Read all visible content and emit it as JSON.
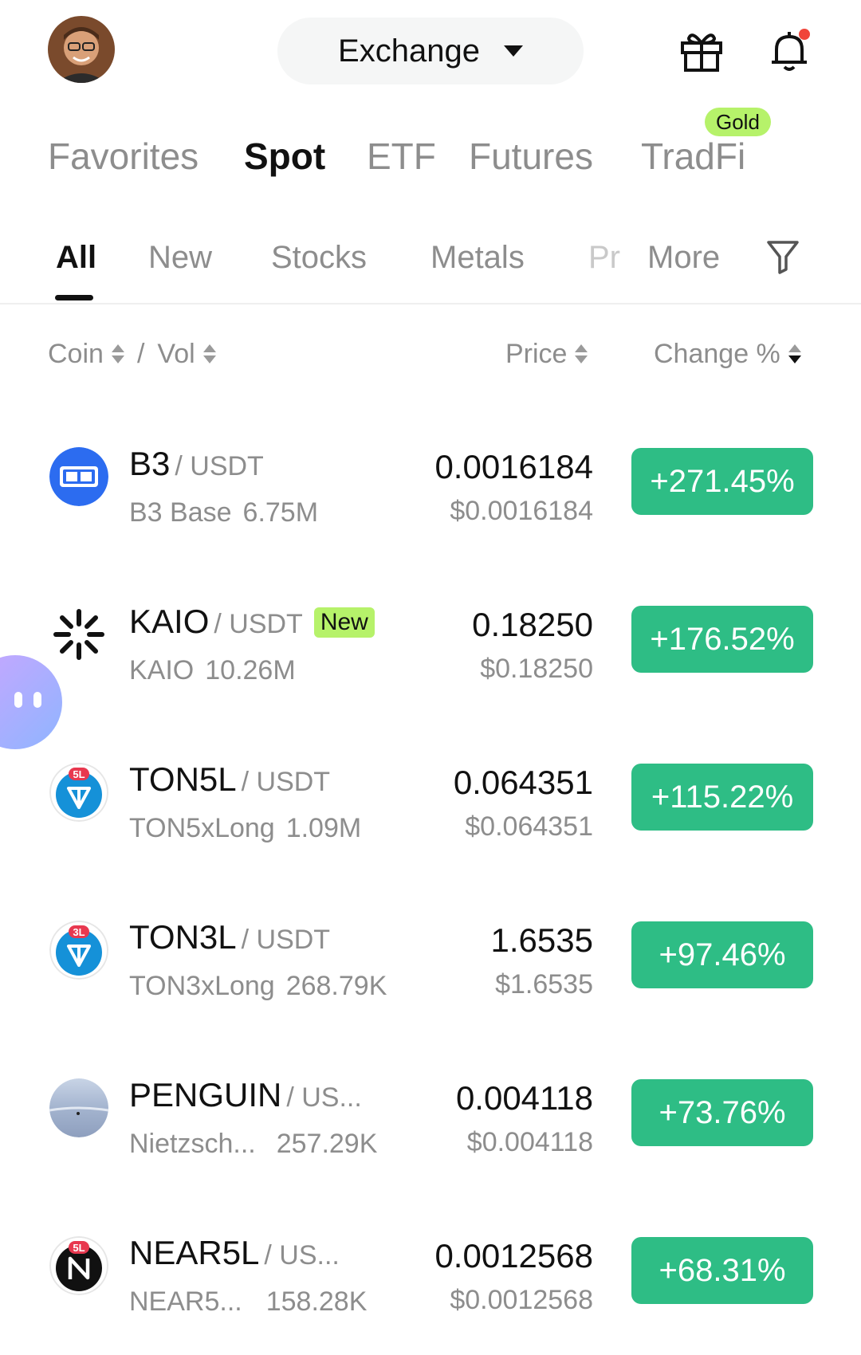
{
  "header": {
    "exchange_label": "Exchange",
    "notification_dot_color": "#f0453a"
  },
  "categories": [
    {
      "label": "Favorites",
      "active": false
    },
    {
      "label": "Spot",
      "active": true
    },
    {
      "label": "ETF",
      "active": false
    },
    {
      "label": "Futures",
      "active": false
    },
    {
      "label": "TradFi",
      "active": false,
      "badge": "Gold"
    }
  ],
  "subtabs": [
    "All",
    "New",
    "Stocks",
    "Metals",
    "Pr",
    "More"
  ],
  "columns": {
    "coin": "Coin",
    "sep": "/",
    "vol": "Vol",
    "price": "Price",
    "change": "Change %"
  },
  "rows": [
    {
      "symbol": "B3",
      "pair": "/ USDT",
      "name": "B3 Base",
      "volume": "6.75M",
      "price": "0.0016184",
      "fiat": "$0.0016184",
      "change": "+271.45%",
      "badge": "",
      "icon": "b3-coin-icon"
    },
    {
      "symbol": "KAIO",
      "pair": "/ USDT",
      "name": "KAIO",
      "volume": "10.26M",
      "price": "0.18250",
      "fiat": "$0.18250",
      "change": "+176.52%",
      "badge": "New",
      "icon": "kaio-coin-icon"
    },
    {
      "symbol": "TON5L",
      "pair": "/ USDT",
      "name": "TON5xLong",
      "volume": "1.09M",
      "price": "0.064351",
      "fiat": "$0.064351",
      "change": "+115.22%",
      "badge": "",
      "icon": "ton5l-coin-icon"
    },
    {
      "symbol": "TON3L",
      "pair": "/ USDT",
      "name": "TON3xLong",
      "volume": "268.79K",
      "price": "1.6535",
      "fiat": "$1.6535",
      "change": "+97.46%",
      "badge": "",
      "icon": "ton3l-coin-icon"
    },
    {
      "symbol": "PENGUIN",
      "pair": "/ US...",
      "name": "Nietzsch...",
      "volume": "257.29K",
      "price": "0.004118",
      "fiat": "$0.004118",
      "change": "+73.76%",
      "badge": "",
      "icon": "penguin-coin-icon"
    },
    {
      "symbol": "NEAR5L",
      "pair": "/ US...",
      "name": "NEAR5...",
      "volume": "158.28K",
      "price": "0.0012568",
      "fiat": "$0.0012568",
      "change": "+68.31%",
      "badge": "",
      "icon": "near5l-coin-icon"
    }
  ],
  "icon_labels": {
    "ton5l": "5L",
    "ton3l": "3L",
    "near5l": "5L"
  },
  "colors": {
    "positive": "#2ebd85",
    "badge": "#b6f26a"
  }
}
